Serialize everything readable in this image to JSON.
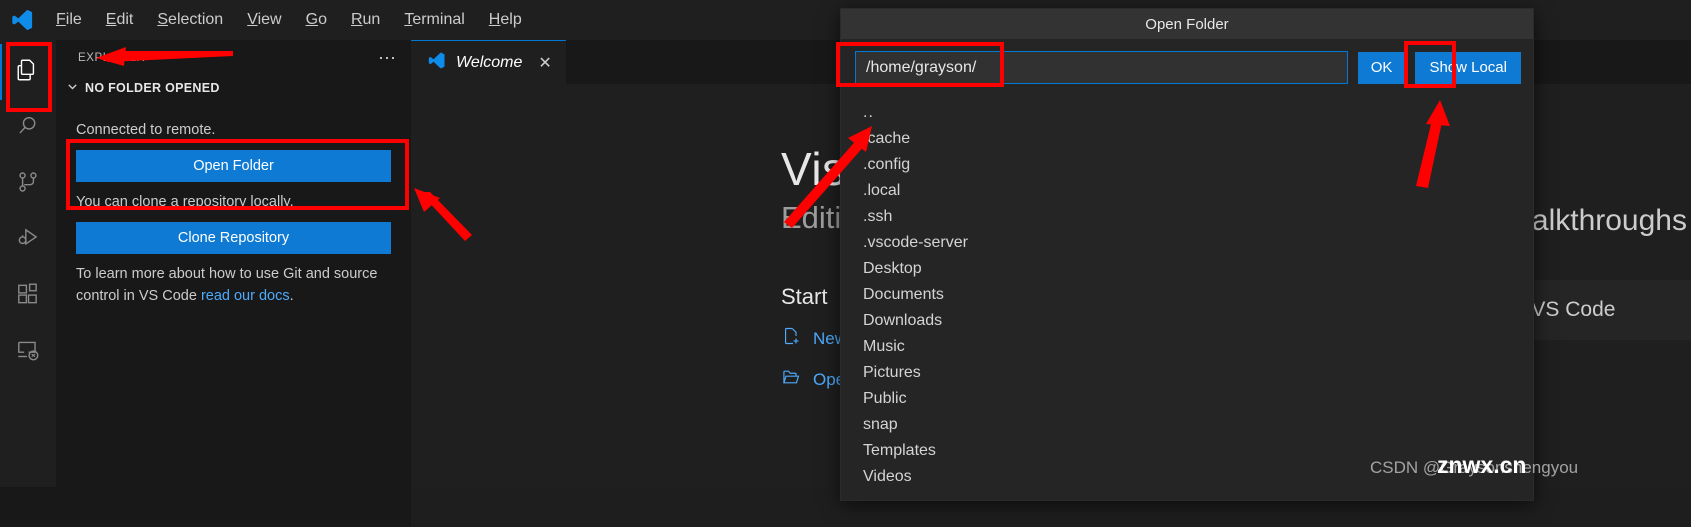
{
  "app": {
    "logo_icon": "vscode-logo-icon",
    "menu": [
      {
        "label": "File",
        "accel": "F"
      },
      {
        "label": "Edit",
        "accel": "E"
      },
      {
        "label": "Selection",
        "accel": "S"
      },
      {
        "label": "View",
        "accel": "V"
      },
      {
        "label": "Go",
        "accel": "G"
      },
      {
        "label": "Run",
        "accel": "R"
      },
      {
        "label": "Terminal",
        "accel": "T"
      },
      {
        "label": "Help",
        "accel": "H"
      }
    ]
  },
  "activity_bar": {
    "items": [
      {
        "name": "explorer",
        "icon": "files-icon",
        "active": true
      },
      {
        "name": "search",
        "icon": "search-icon",
        "active": false
      },
      {
        "name": "source-control",
        "icon": "source-control-icon",
        "active": false
      },
      {
        "name": "run-and-debug",
        "icon": "run-debug-icon",
        "active": false
      },
      {
        "name": "extensions",
        "icon": "extensions-icon",
        "active": false
      },
      {
        "name": "remote-explorer",
        "icon": "remote-explorer-icon",
        "active": false
      }
    ]
  },
  "sidebar": {
    "title": "EXPLORER",
    "more_actions_icon": "ellipsis-icon",
    "section": {
      "label": "NO FOLDER OPENED",
      "chevron": "⌄"
    },
    "connected_text": "Connected to remote.",
    "open_folder_button": "Open Folder",
    "clone_text": "You can clone a repository locally.",
    "clone_button": "Clone Repository",
    "docs_text_before": "To learn more about how to use Git and source control in VS Code ",
    "docs_link": "read our docs",
    "docs_text_after": "."
  },
  "editor": {
    "tab": {
      "icon": "vscode-logo-icon",
      "label": "Welcome",
      "close_icon": "close-icon"
    },
    "welcome": {
      "heading": "Visual Studio Code",
      "subheading": "Editing evolved",
      "start_label": "Start",
      "links": [
        {
          "label": "New File...",
          "icon": "new-file-icon"
        },
        {
          "label": "Open File...",
          "icon": "open-file-icon"
        }
      ],
      "right_line1": "Walkthroughs",
      "right_line2": "Get Started with VS Code"
    }
  },
  "dialog": {
    "title": "Open Folder",
    "path_value": "/home/grayson/",
    "path_placeholder": "/home/grayson/",
    "ok_button": "OK",
    "show_local_button": "Show Local",
    "entries": [
      "..",
      ".cache",
      ".config",
      ".local",
      ".ssh",
      ".vscode-server",
      "Desktop",
      "Documents",
      "Downloads",
      "Music",
      "Pictures",
      "Public",
      "snap",
      "Templates",
      "Videos"
    ]
  },
  "annotations": {
    "color": "#fe0000",
    "highlight_boxes": [
      {
        "name": "explorer-icon-highlight"
      },
      {
        "name": "open-folder-button-highlight"
      },
      {
        "name": "path-input-highlight"
      },
      {
        "name": "ok-button-highlight"
      }
    ],
    "arrows": [
      {
        "name": "arrow-to-explorer-title"
      },
      {
        "name": "arrow-to-open-folder-box"
      },
      {
        "name": "arrow-to-file-list"
      },
      {
        "name": "arrow-to-ok-button"
      }
    ]
  },
  "watermarks": {
    "csdn": "CSDN @Graysonshengyou",
    "znwx": "znwx.cn"
  }
}
